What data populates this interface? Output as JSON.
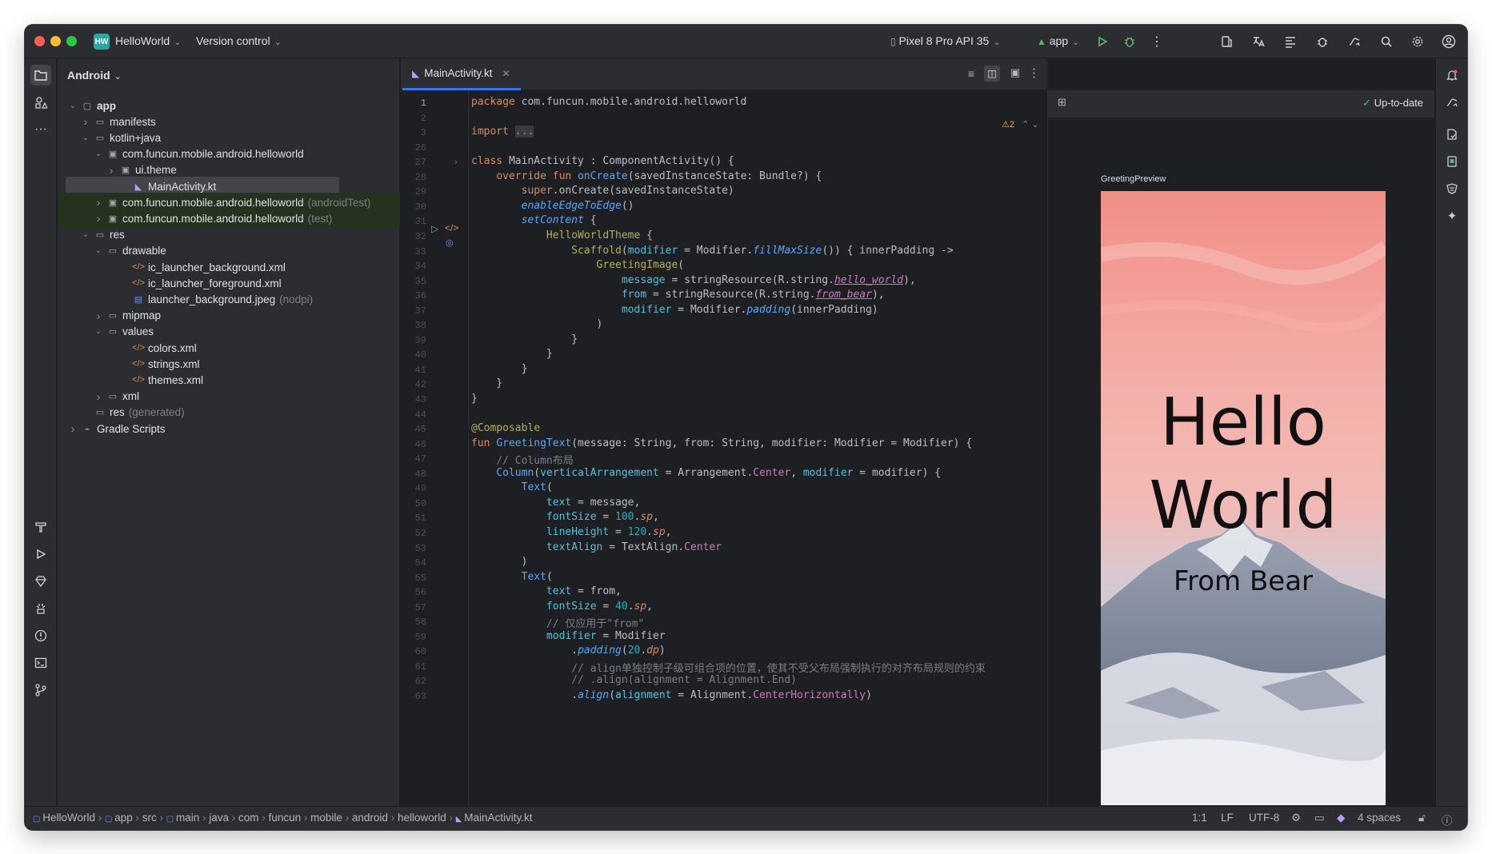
{
  "titlebar": {
    "project_badge": "HW",
    "project": "HelloWorld",
    "vcs": "Version control",
    "device": "Pixel 8 Pro API 35",
    "run_config": "app"
  },
  "project_panel": {
    "title": "Android",
    "tree": [
      {
        "label": "app",
        "suffix": "",
        "indent": 0,
        "arrow": "down",
        "icon": "module-folder-icon",
        "bold": true
      },
      {
        "label": "manifests",
        "suffix": "",
        "indent": 1,
        "arrow": "right",
        "icon": "folder-icon"
      },
      {
        "label": "kotlin+java",
        "suffix": "",
        "indent": 1,
        "arrow": "down",
        "icon": "folder-icon"
      },
      {
        "label": "com.funcun.mobile.android.helloworld",
        "suffix": "",
        "indent": 2,
        "arrow": "down",
        "icon": "package-icon"
      },
      {
        "label": "ui.theme",
        "suffix": "",
        "indent": 3,
        "arrow": "right",
        "icon": "package-icon"
      },
      {
        "label": "MainActivity.kt",
        "suffix": "",
        "indent": 4,
        "arrow": "",
        "icon": "kotlin-file-icon",
        "selected": true
      },
      {
        "label": "com.funcun.mobile.android.helloworld",
        "suffix": "(androidTest)",
        "indent": 2,
        "arrow": "right",
        "icon": "package-icon",
        "test": true
      },
      {
        "label": "com.funcun.mobile.android.helloworld",
        "suffix": "(test)",
        "indent": 2,
        "arrow": "right",
        "icon": "package-icon",
        "test": true
      },
      {
        "label": "res",
        "suffix": "",
        "indent": 1,
        "arrow": "down",
        "icon": "res-folder-icon"
      },
      {
        "label": "drawable",
        "suffix": "",
        "indent": 2,
        "arrow": "down",
        "icon": "folder-icon"
      },
      {
        "label": "ic_launcher_background.xml",
        "suffix": "",
        "indent": 4,
        "arrow": "",
        "icon": "xml-file-icon"
      },
      {
        "label": "ic_launcher_foreground.xml",
        "suffix": "",
        "indent": 4,
        "arrow": "",
        "icon": "xml-file-icon"
      },
      {
        "label": "launcher_background.jpeg",
        "suffix": "(nodpi)",
        "indent": 4,
        "arrow": "",
        "icon": "image-file-icon"
      },
      {
        "label": "mipmap",
        "suffix": "",
        "indent": 2,
        "arrow": "right",
        "icon": "folder-icon"
      },
      {
        "label": "values",
        "suffix": "",
        "indent": 2,
        "arrow": "down",
        "icon": "folder-icon"
      },
      {
        "label": "colors.xml",
        "suffix": "",
        "indent": 4,
        "arrow": "",
        "icon": "xml-file-icon"
      },
      {
        "label": "strings.xml",
        "suffix": "",
        "indent": 4,
        "arrow": "",
        "icon": "xml-file-icon"
      },
      {
        "label": "themes.xml",
        "suffix": "",
        "indent": 4,
        "arrow": "",
        "icon": "xml-file-icon"
      },
      {
        "label": "xml",
        "suffix": "",
        "indent": 2,
        "arrow": "right",
        "icon": "folder-icon"
      },
      {
        "label": "res",
        "suffix": "(generated)",
        "indent": 1,
        "arrow": "",
        "icon": "res-folder-icon"
      },
      {
        "label": "Gradle Scripts",
        "suffix": "",
        "indent": 0,
        "arrow": "right",
        "icon": "gradle-icon"
      }
    ]
  },
  "editor": {
    "tab_label": "MainActivity.kt",
    "warning_count": "2",
    "lines": [
      {
        "n": "1",
        "html": "<span class='kw'>package</span> com.funcun.mobile.android.helloworld"
      },
      {
        "n": "2",
        "html": ""
      },
      {
        "n": "3",
        "html": "<span class='kw'>import</span> <span style='background:#393b40;color:#8c8f94'>...</span>"
      },
      {
        "n": "26",
        "html": ""
      },
      {
        "n": "27",
        "html": "<span class='kw'>class</span> MainActivity : ComponentActivity() {"
      },
      {
        "n": "28",
        "html": "    <span class='kw'>override fun</span> <span class='fn'>onCreate</span>(savedInstanceState: Bundle?) {"
      },
      {
        "n": "29",
        "html": "        <span class='kw'>super</span>.onCreate(savedInstanceState)"
      },
      {
        "n": "30",
        "html": "        <span class='it'>enableEdgeToEdge</span>()"
      },
      {
        "n": "31",
        "html": "        <span class='it'>setContent</span> {"
      },
      {
        "n": "32",
        "html": "            <span style='color:#b3ae60'>HelloWorldTheme</span> {"
      },
      {
        "n": "33",
        "html": "                <span style='color:#b3ae60'>Scaffold</span>(<span class='pm'>modifier</span> = Modifier.<span class='it'>fillMaxSize</span>()) { innerPadding ->"
      },
      {
        "n": "34",
        "html": "                    <span style='color:#b3ae60'>GreetingImage</span>("
      },
      {
        "n": "35",
        "html": "                        <span class='pm'>message</span> = stringResource(R.string.<span class='pr' style='font-style:italic;text-decoration:underline'>hello_world</span>),"
      },
      {
        "n": "36",
        "html": "                        <span class='pm'>from</span> = stringResource(R.string.<span class='pr' style='font-style:italic;text-decoration:underline'>from_bear</span>),"
      },
      {
        "n": "37",
        "html": "                        <span class='pm'>modifier</span> = Modifier.<span class='it'>padding</span>(innerPadding)"
      },
      {
        "n": "38",
        "html": "                    )"
      },
      {
        "n": "39",
        "html": "                }"
      },
      {
        "n": "40",
        "html": "            }"
      },
      {
        "n": "41",
        "html": "        }"
      },
      {
        "n": "42",
        "html": "    }"
      },
      {
        "n": "43",
        "html": "}"
      },
      {
        "n": "44",
        "html": ""
      },
      {
        "n": "45",
        "html": "<span class='an'>@Composable</span>"
      },
      {
        "n": "46",
        "html": "<span class='kw'>fun</span> <span class='fn'>GreetingText</span>(message: String, from: String, modifier: Modifier = Modifier) {"
      },
      {
        "n": "47",
        "html": "    <span class='cm'>// Column布局</span>"
      },
      {
        "n": "48",
        "html": "    <span style='color:#56a8f5'>Column</span>(<span class='pm'>verticalArrangement</span> = Arrangement.<span class='prop'>Center</span>, <span class='pm'>modifier</span> = modifier) {"
      },
      {
        "n": "49",
        "html": "        <span style='color:#56a8f5'>Text</span>("
      },
      {
        "n": "50",
        "html": "            <span class='pm'>text</span> = message,"
      },
      {
        "n": "51",
        "html": "            <span class='pm'>fontSize</span> = <span class='nm'>100</span>.<span class='un'>sp</span>,"
      },
      {
        "n": "52",
        "html": "            <span class='pm'>lineHeight</span> = <span class='nm'>120</span>.<span class='un'>sp</span>,"
      },
      {
        "n": "53",
        "html": "            <span class='pm'>textAlign</span> = TextAlign.<span class='prop'>Center</span>"
      },
      {
        "n": "54",
        "html": "        )"
      },
      {
        "n": "55",
        "html": "        <span style='color:#56a8f5'>Text</span>("
      },
      {
        "n": "56",
        "html": "            <span class='pm'>text</span> = from,"
      },
      {
        "n": "57",
        "html": "            <span class='pm'>fontSize</span> = <span class='nm'>40</span>.<span class='un'>sp</span>,"
      },
      {
        "n": "58",
        "html": "            <span class='cm'>// 仅应用于\"from\"</span>"
      },
      {
        "n": "59",
        "html": "            <span class='pm'>modifier</span> = Modifier"
      },
      {
        "n": "60",
        "html": "                .<span class='it'>padding</span>(<span class='nm'>20</span>.<span class='un'>dp</span>)"
      },
      {
        "n": "61",
        "html": "                <span class='cm'>// align单独控制子级可组合项的位置，使其不受父布局强制执行的对齐布局规则的约束</span>"
      },
      {
        "n": "62",
        "html": "                <span class='cm'>// .align(alignment = Alignment.End)</span>"
      },
      {
        "n": "63",
        "html": "                .<span class='it'>align</span>(<span class='pm'>alignment</span> = Alignment.<span class='prop'>CenterHorizontally</span>)"
      }
    ]
  },
  "preview": {
    "status": "Up-to-date",
    "title": "GreetingPreview",
    "hello": "Hello",
    "world": "World",
    "from": "From Bear"
  },
  "breadcrumb": [
    "HelloWorld",
    "app",
    "src",
    "main",
    "java",
    "com",
    "funcun",
    "mobile",
    "android",
    "helloworld",
    "MainActivity.kt"
  ],
  "status": {
    "position": "1:1",
    "line_sep": "LF",
    "encoding": "UTF-8",
    "indent": "4 spaces"
  },
  "colors": {
    "accent": "#3574f0",
    "selection": "#43454a",
    "test_bg": "#243025"
  }
}
